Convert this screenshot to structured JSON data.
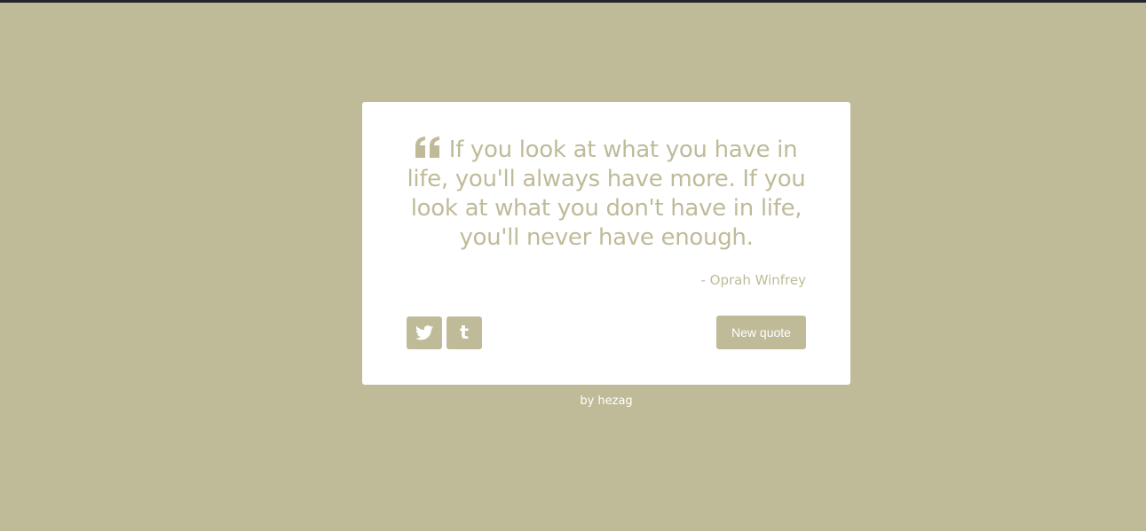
{
  "colors": {
    "background": "#bfbb99",
    "top_bar": "#23232b",
    "card": "#ffffff",
    "accent": "#bfbb99",
    "credit_text": "#ffffff"
  },
  "quote": {
    "icon": "quote-left-icon",
    "text": "If you look at what you have in life, you'll always have more. If you look at what you don't have in life, you'll never have enough.",
    "author": "- Oprah Winfrey"
  },
  "actions": {
    "twitter_icon": "twitter-icon",
    "tumblr_icon": "tumblr-icon",
    "tumblr_glyph": "t",
    "new_quote_label": "New quote"
  },
  "footer": {
    "prefix": "by ",
    "author": "hezag"
  }
}
